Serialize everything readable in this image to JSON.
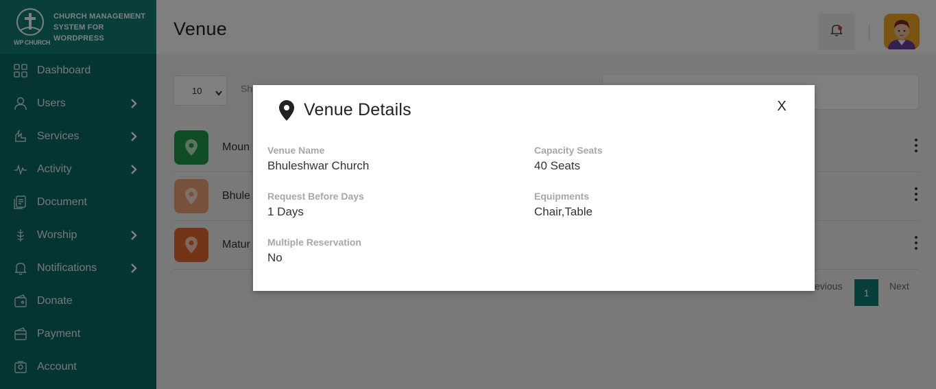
{
  "brand": {
    "logo_text": "WP CHURCH",
    "title_lines": [
      "CHURCH MANAGEMENT",
      "SYSTEM FOR",
      "WORDPRESS"
    ]
  },
  "sidebar": {
    "items": [
      {
        "label": "Dashboard",
        "icon": "dashboard-grid-icon",
        "has_submenu": false
      },
      {
        "label": "Users",
        "icon": "user-icon",
        "has_submenu": true
      },
      {
        "label": "Services",
        "icon": "services-icon",
        "has_submenu": true
      },
      {
        "label": "Activity",
        "icon": "activity-pulse-icon",
        "has_submenu": true
      },
      {
        "label": "Document",
        "icon": "document-icon",
        "has_submenu": false
      },
      {
        "label": "Worship",
        "icon": "worship-icon",
        "has_submenu": true
      },
      {
        "label": "Notifications",
        "icon": "bell-icon",
        "has_submenu": true
      },
      {
        "label": "Donate",
        "icon": "donate-icon",
        "has_submenu": false
      },
      {
        "label": "Payment",
        "icon": "payment-icon",
        "has_submenu": false
      },
      {
        "label": "Account",
        "icon": "account-icon",
        "has_submenu": false
      }
    ]
  },
  "header": {
    "title": "Venue"
  },
  "table": {
    "page_size": "10",
    "search_hint": "Sh",
    "rows": [
      {
        "name": "Moun",
        "icon_color": "#1f9a4a"
      },
      {
        "name": "Bhule",
        "icon_color": "#f0a27a"
      },
      {
        "name": "Matur",
        "icon_color": "#e8692f"
      }
    ],
    "pagination": {
      "previous": "Previous",
      "current": "1",
      "next": "Next"
    }
  },
  "modal": {
    "title": "Venue Details",
    "close_label": "X",
    "fields": {
      "venue_name": {
        "label": "Venue Name",
        "value": "Bhuleshwar Church"
      },
      "capacity": {
        "label": "Capacity Seats",
        "value": "40 Seats"
      },
      "request_before": {
        "label": "Request Before Days",
        "value": "1 Days"
      },
      "equipments": {
        "label": "Equipments",
        "value": "Chair,Table"
      },
      "multiple_reservation": {
        "label": "Multiple Reservation",
        "value": "No"
      }
    }
  },
  "colors": {
    "sidebar": "#0b6b64",
    "brand": "#107e76",
    "accent": "#107e76"
  }
}
